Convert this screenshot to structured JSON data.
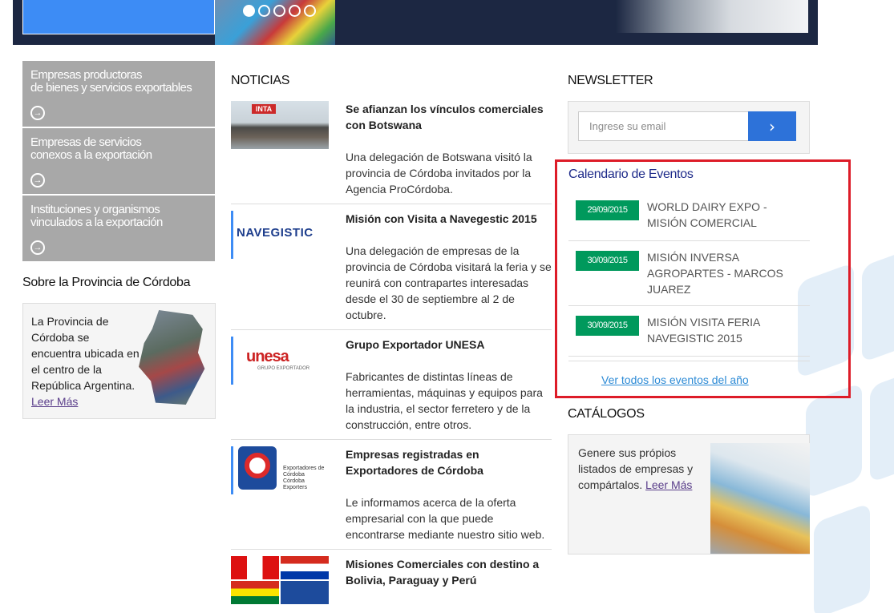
{
  "slider": {
    "dots": 5,
    "active": 0
  },
  "left_menu": {
    "items": [
      {
        "label_line1": "Empresas productoras",
        "label_line2": "de bienes y servicios exportables"
      },
      {
        "label_line1": "Empresas de servicios",
        "label_line2": "conexos a la exportación"
      },
      {
        "label_line1": "Instituciones y organismos",
        "label_line2": "vinculados a la exportación"
      }
    ]
  },
  "sobre": {
    "title": "Sobre la Provincia de Córdoba",
    "text": "La Provincia de Córdoba se encuentra ubicada en el centro de la República Argentina.",
    "link": "Leer Más"
  },
  "news": {
    "title": "NOTICIAS",
    "items": [
      {
        "headline": "Se afianzan los vínculos comerciales con Botswana",
        "body": "Una delegación de Botswana visitó la provincia de Córdoba invitados por la Agencia ProCórdoba.",
        "image_sign": "INTA"
      },
      {
        "headline": "Misión con Visita a Navegestic 2015",
        "body": "Una delegación de empresas de la provincia de Córdoba visitará la feria y se reunirá con contrapartes interesadas desde el 30 de septiembre al 2 de octubre.",
        "logo": "NAVEGISTIC"
      },
      {
        "headline": "Grupo Exportador UNESA",
        "body": "Fabricantes de distintas líneas de herramientas, máquinas y equipos para la industria, el sector ferretero y de la construcción, entre otros.",
        "logo": "unesa",
        "logo_sub": "GRUPO EXPORTADOR"
      },
      {
        "headline": "Empresas registradas en Exportadores de Córdoba",
        "body": "Le informamos acerca de la oferta empresarial con la que puede encontrarse mediante nuestro sitio web.",
        "logo_line1": "Exportadores de",
        "logo_line2": "Córdoba",
        "logo_line3": "Córdoba Exporters"
      },
      {
        "headline": "Misiones Comerciales con destino a Bolivia, Paraguay y Perú",
        "body": ""
      }
    ]
  },
  "newsletter": {
    "title": "NEWSLETTER",
    "placeholder": "Ingrese su email",
    "button": "›"
  },
  "calendar": {
    "title": "Calendario de Eventos",
    "events": [
      {
        "date": "29/09/2015",
        "text": "WORLD DAIRY EXPO - MISIÓN COMERCIAL"
      },
      {
        "date": "30/09/2015",
        "text": "MISIÓN INVERSA AGROPARTES - MARCOS JUAREZ"
      },
      {
        "date": "30/09/2015",
        "text": "MISIÓN VISITA FERIA NAVEGISTIC 2015"
      }
    ],
    "all_link": "Ver todos los eventos del año",
    "highlight_color": "#dd1c28",
    "date_color": "#00995c"
  },
  "catalogos": {
    "title": "CATÁLOGOS",
    "text": "Genere sus própios listados de empresas y compártalos.",
    "link": "Leer Más"
  }
}
